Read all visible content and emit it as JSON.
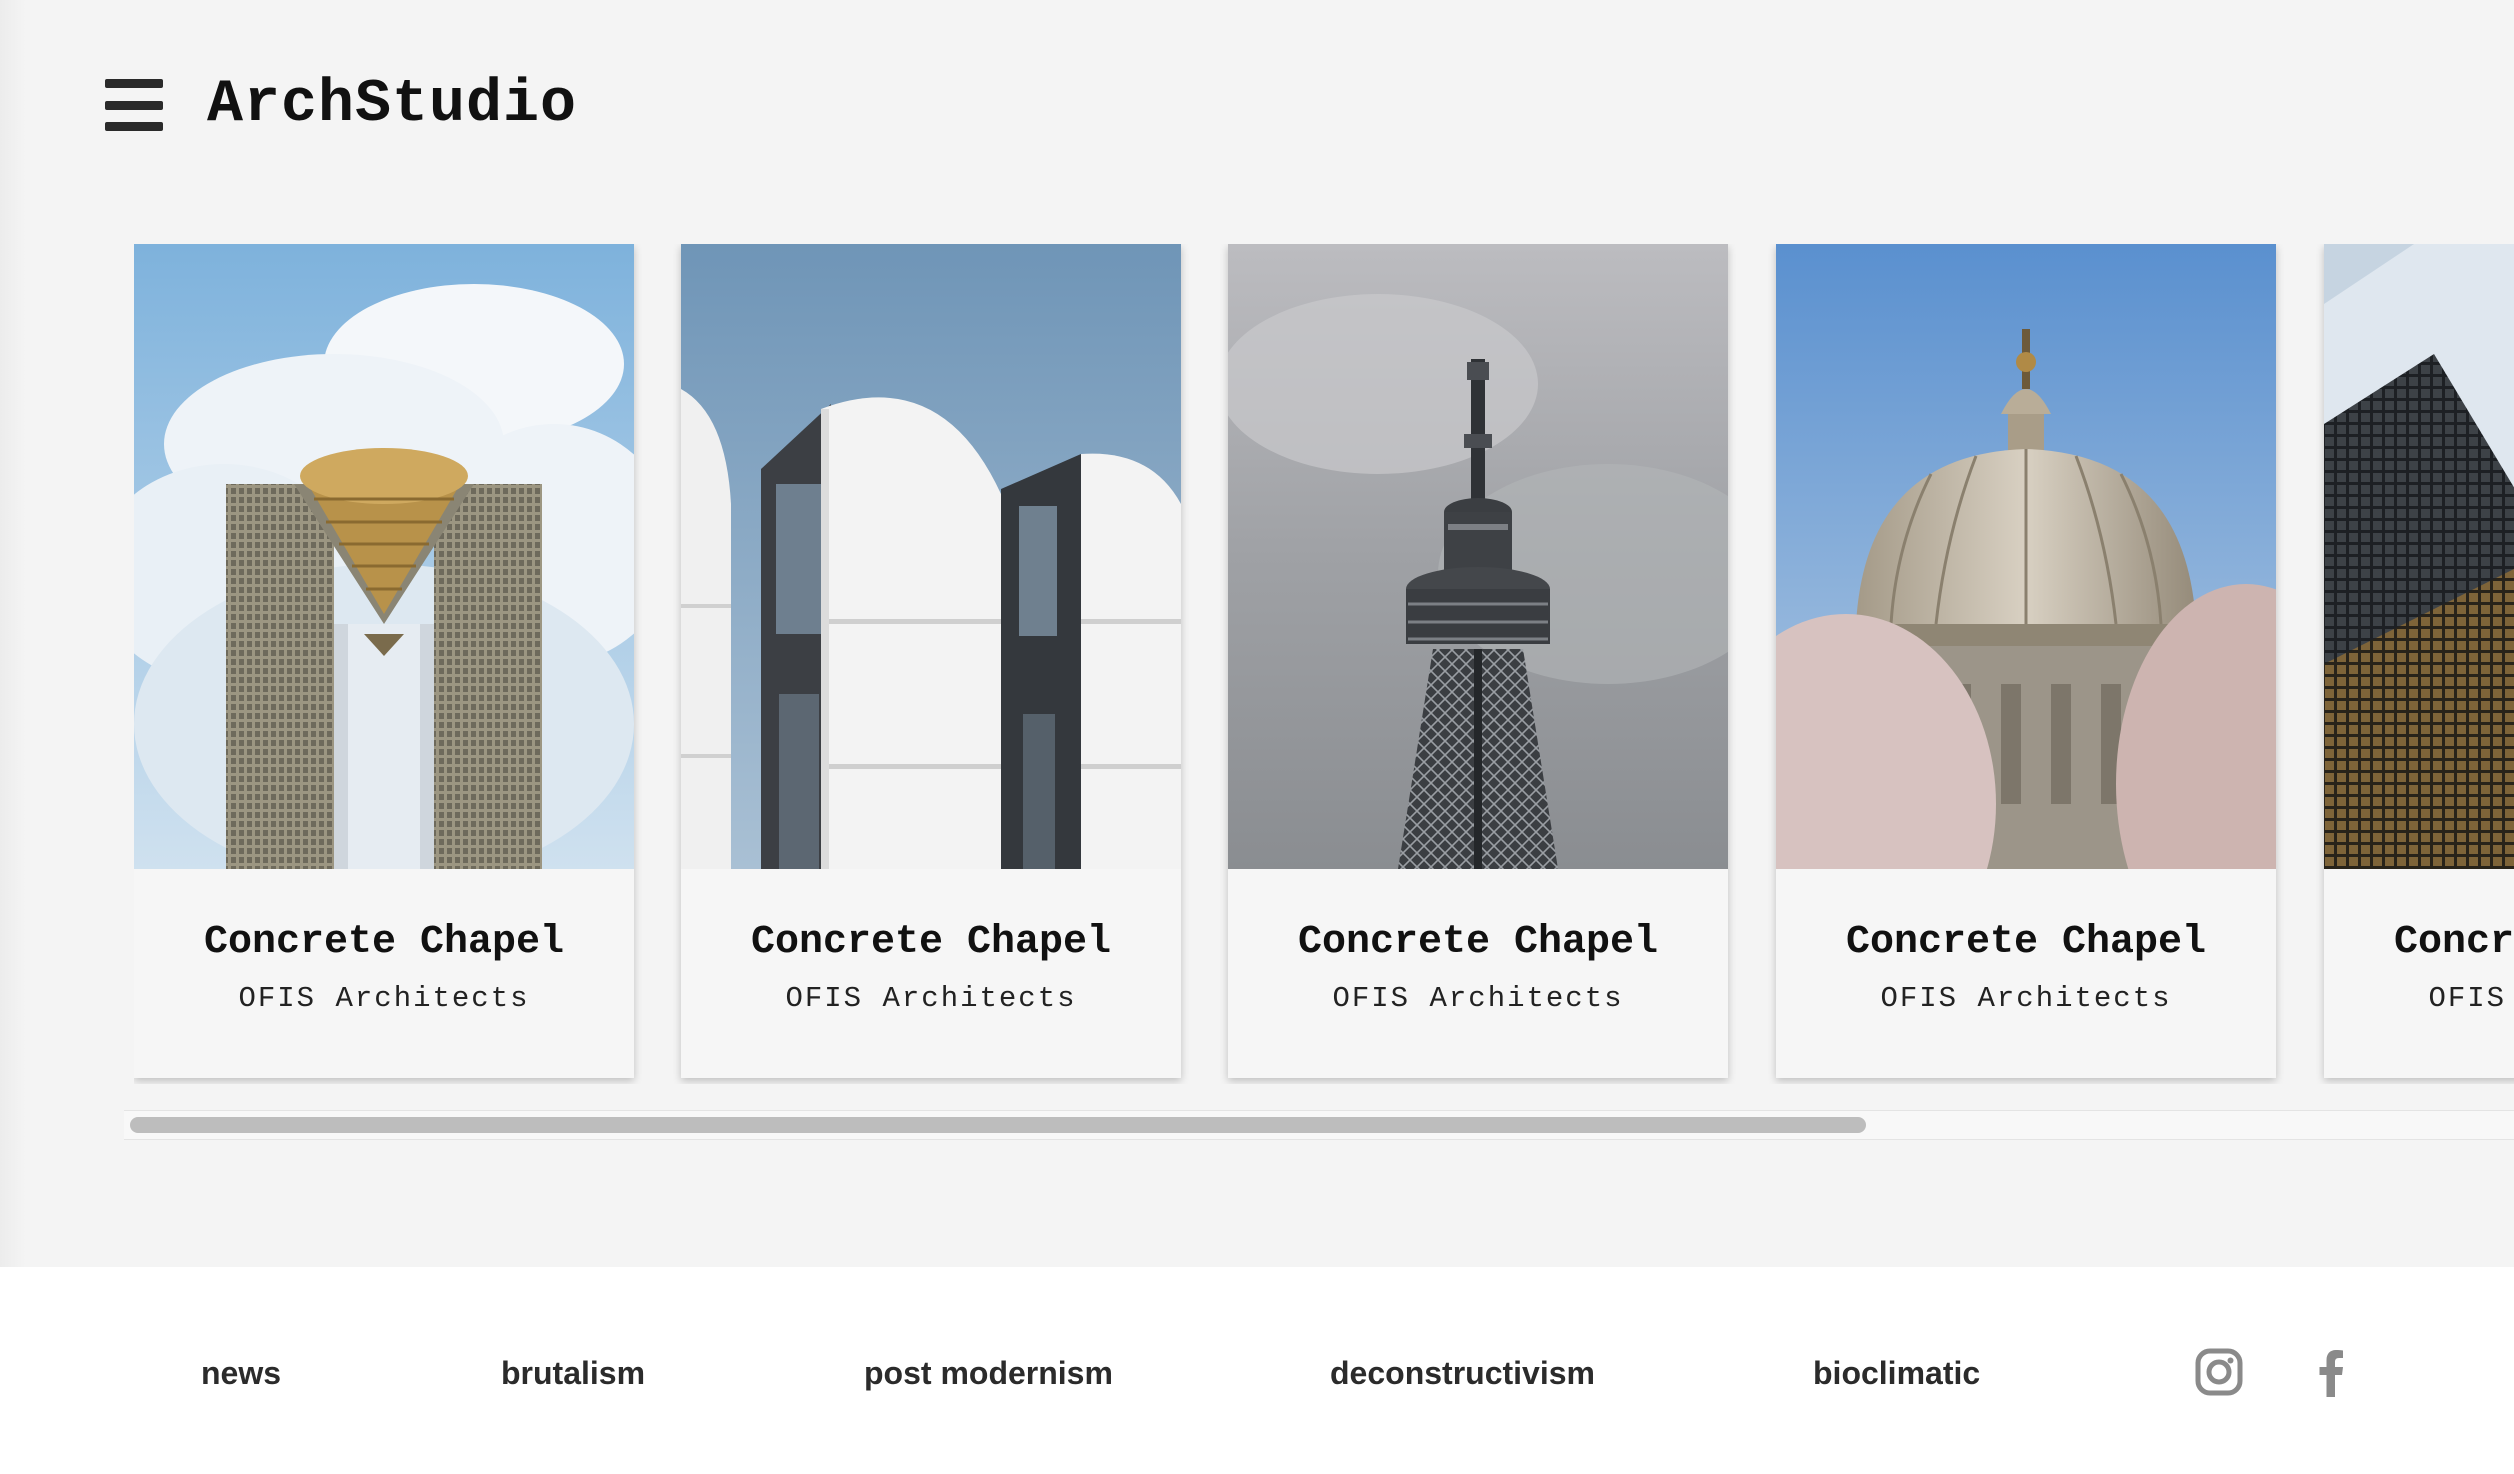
{
  "header": {
    "brand": "ArchStudio",
    "menu_icon": "hamburger-menu-icon"
  },
  "cards": [
    {
      "title": "Concrete Chapel",
      "subtitle": "OFIS Architects",
      "image": "m-shaped-skyscraper-photo"
    },
    {
      "title": "Concrete Chapel",
      "subtitle": "OFIS Architects",
      "image": "white-arched-modernist-building-photo"
    },
    {
      "title": "Concrete Chapel",
      "subtitle": "OFIS Architects",
      "image": "lattice-tv-tower-photo"
    },
    {
      "title": "Concrete Chapel",
      "subtitle": "OFIS Architects",
      "image": "ornate-dome-photo"
    },
    {
      "title": "Concrete Chapel",
      "subtitle": "OFIS Architects",
      "image": "glass-skyscrapers-photo"
    }
  ],
  "scrollbar": {
    "position_fraction": 0,
    "visible_fraction": 0.73
  },
  "footer": {
    "links": [
      "news",
      "brutalism",
      "post modernism",
      "deconstructivism",
      "bioclimatic"
    ],
    "social_icons": [
      "instagram-icon",
      "facebook-icon"
    ]
  },
  "colors": {
    "background": "#f4f4f4",
    "footer_background": "#ffffff",
    "text": "#111111",
    "icon_gray": "#8a8a8a"
  }
}
